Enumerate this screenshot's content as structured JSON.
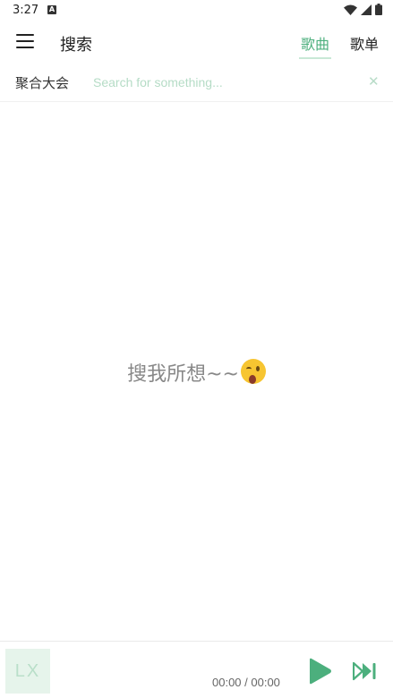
{
  "status_bar": {
    "time": "3:27",
    "notification_badge": "A",
    "icons": [
      "wifi-icon",
      "signal-icon",
      "battery-icon"
    ]
  },
  "toolbar": {
    "menu_icon": "hamburger-menu-icon",
    "title": "搜索",
    "tabs": [
      {
        "label": "歌曲",
        "active": true
      },
      {
        "label": "歌单",
        "active": false
      }
    ]
  },
  "search": {
    "source": "聚合大会",
    "placeholder": "Search for something...",
    "value": "",
    "clear_icon": "close-icon"
  },
  "main": {
    "empty_text": "搜我所想~~",
    "emoji": "winking-face-emoji"
  },
  "player": {
    "cover_text": "LX",
    "time": "00:00 / 00:00",
    "play_icon": "play-icon",
    "next_icon": "skip-next-icon"
  },
  "colors": {
    "accent": "#4caf7d",
    "accent_light": "#b5dcc6",
    "cover_bg": "#e6f4eb"
  }
}
